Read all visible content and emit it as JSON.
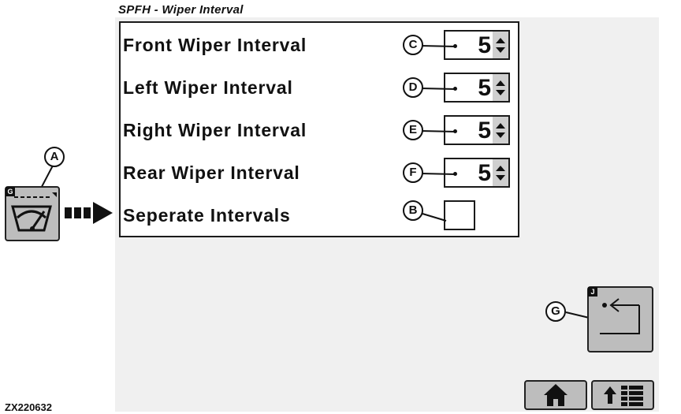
{
  "screen": {
    "title": "SPFH - Wiper Interval"
  },
  "rows": [
    {
      "label": "Front Wiper Interval",
      "value": "5",
      "callout": "C"
    },
    {
      "label": "Left Wiper Interval",
      "value": "5",
      "callout": "D"
    },
    {
      "label": "Right Wiper Interval",
      "value": "5",
      "callout": "E"
    },
    {
      "label": "Rear Wiper Interval",
      "value": "5",
      "callout": "F"
    }
  ],
  "separate": {
    "label": "Seperate Intervals",
    "callout": "B",
    "checked": false
  },
  "wiper_button": {
    "callout": "A",
    "corner_tag": "G",
    "icon": "wiper-icon"
  },
  "back_button": {
    "callout": "G",
    "corner_tag": "J",
    "icon": "back-arrow-icon"
  },
  "nav": {
    "home_icon": "home-icon",
    "menu_icon": "up-arrow-menu-icon"
  },
  "figure_code": "ZX220632"
}
